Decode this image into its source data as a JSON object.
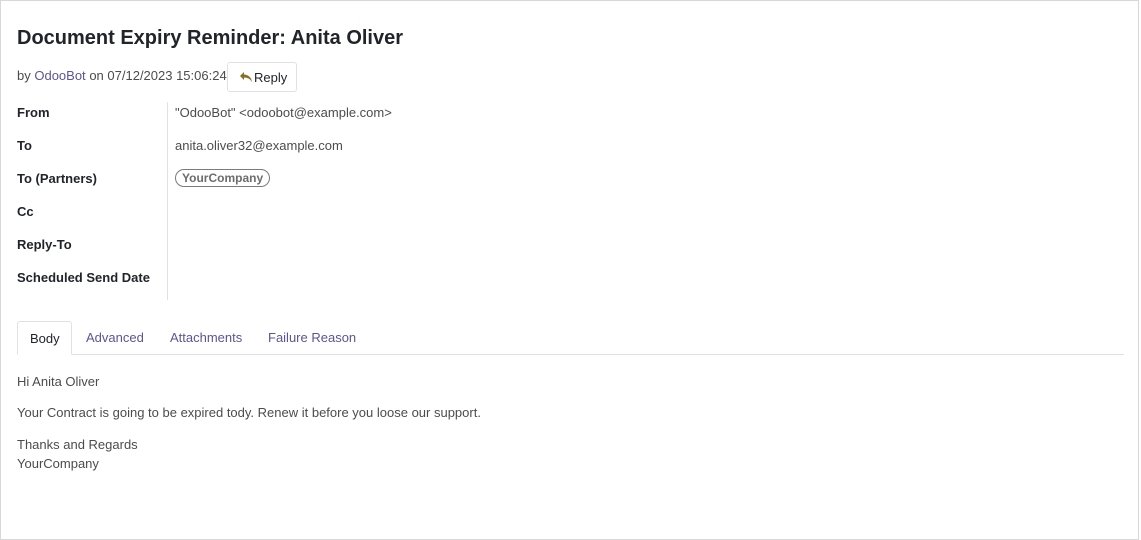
{
  "message": {
    "title": "Document Expiry Reminder: Anita Oliver",
    "by_label": "by",
    "author": "OdooBot",
    "on_label": "on",
    "date": "07/12/2023 15:06:24",
    "reply_label": "Reply",
    "reply_icon": "reply-arrow-icon"
  },
  "fields": {
    "from": {
      "label": "From",
      "value": "\"OdooBot\" <odoobot@example.com>"
    },
    "to": {
      "label": "To",
      "value": "anita.oliver32@example.com"
    },
    "to_partners": {
      "label": "To (Partners)",
      "tag": "YourCompany"
    },
    "cc": {
      "label": "Cc",
      "value": ""
    },
    "reply_to": {
      "label": "Reply-To",
      "value": ""
    },
    "scheduled_send_date": {
      "label": "Scheduled Send Date",
      "value": ""
    }
  },
  "tabs": [
    {
      "label": "Body",
      "active": true
    },
    {
      "label": "Advanced",
      "active": false
    },
    {
      "label": "Attachments",
      "active": false
    },
    {
      "label": "Failure Reason",
      "active": false
    }
  ],
  "body": {
    "greeting": "Hi Anita Oliver",
    "line1": "Your Contract is going to be expired tody. Renew it before you loose our support.",
    "closing": "Thanks and Regards",
    "signature": "YourCompany"
  },
  "colors": {
    "link": "#5d5497",
    "reply_icon": "#8a6d1f"
  }
}
